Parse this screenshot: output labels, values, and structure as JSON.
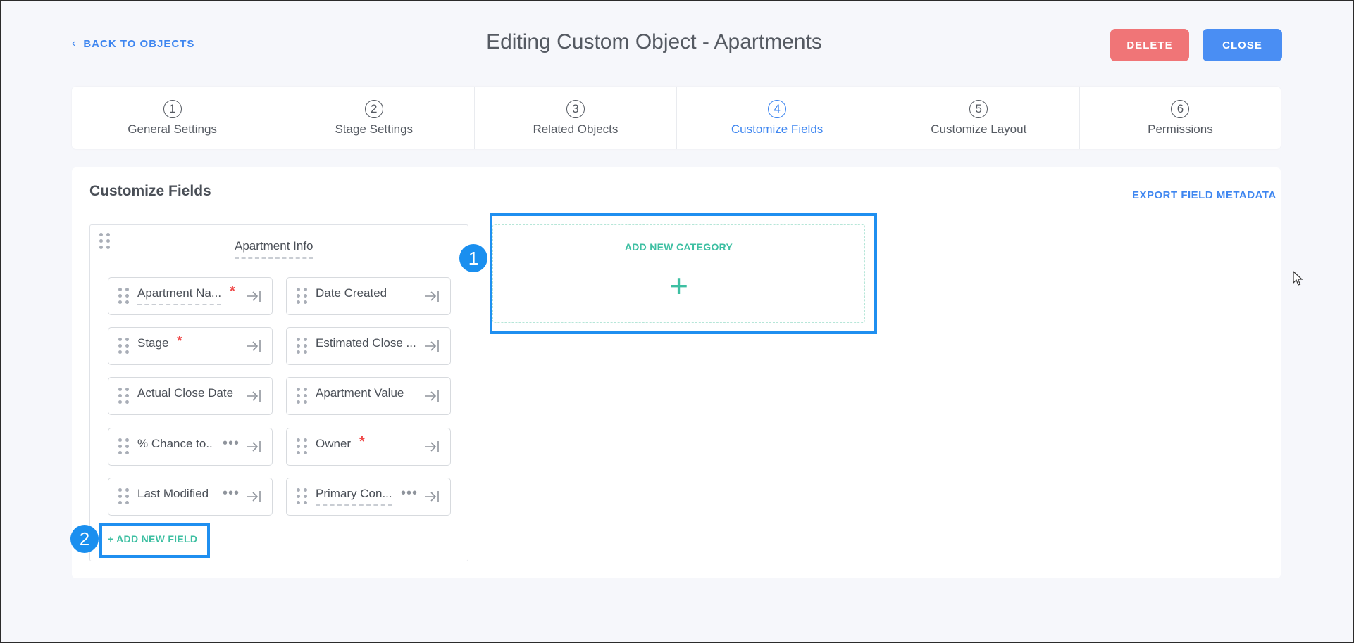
{
  "header": {
    "back_label": "BACK TO OBJECTS",
    "title": "Editing Custom Object - Apartments",
    "delete_label": "DELETE",
    "close_label": "CLOSE"
  },
  "steps": [
    {
      "num": "1",
      "label": "General Settings",
      "active": false
    },
    {
      "num": "2",
      "label": "Stage Settings",
      "active": false
    },
    {
      "num": "3",
      "label": "Related Objects",
      "active": false
    },
    {
      "num": "4",
      "label": "Customize Fields",
      "active": true
    },
    {
      "num": "5",
      "label": "Customize Layout",
      "active": false
    },
    {
      "num": "6",
      "label": "Permissions",
      "active": false
    }
  ],
  "panel": {
    "title": "Customize Fields",
    "export_label": "EXPORT FIELD METADATA"
  },
  "category": {
    "title": "Apartment Info",
    "fields": [
      {
        "name": "Apartment Na...",
        "required": true,
        "more": false,
        "dashed": true
      },
      {
        "name": "Date Created",
        "required": false,
        "more": false,
        "dashed": false
      },
      {
        "name": "Stage",
        "required": true,
        "more": false,
        "dashed": false
      },
      {
        "name": "Estimated Close ...",
        "required": false,
        "more": false,
        "dashed": false
      },
      {
        "name": "Actual Close Date",
        "required": false,
        "more": false,
        "dashed": false
      },
      {
        "name": "Apartment Value",
        "required": false,
        "more": false,
        "dashed": false
      },
      {
        "name": "% Chance to..",
        "required": false,
        "more": true,
        "dashed": false
      },
      {
        "name": "Owner",
        "required": true,
        "more": false,
        "dashed": false
      },
      {
        "name": "Last Modified",
        "required": false,
        "more": true,
        "dashed": false
      },
      {
        "name": "Primary Con...",
        "required": false,
        "more": true,
        "dashed": true
      }
    ],
    "add_field_label": "+ ADD NEW FIELD"
  },
  "new_category": {
    "label": "ADD NEW CATEGORY",
    "plus": "+"
  },
  "annotations": {
    "badge_1": "1",
    "badge_2": "2"
  },
  "colors": {
    "accent_blue": "#3e86f0",
    "accent_green": "#3dbfa2",
    "delete_red": "#f07577",
    "highlight_blue": "#1f8ff0",
    "required_red": "#f04848"
  }
}
